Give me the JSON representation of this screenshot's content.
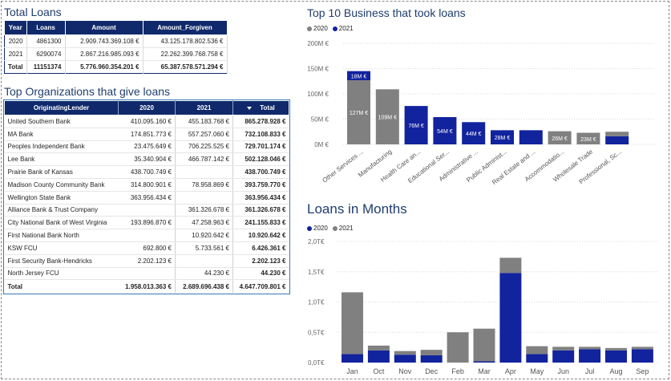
{
  "colors": {
    "c2020": "#808080",
    "c2021": "#12239e",
    "header": "#10296b",
    "title": "#1f3d6d"
  },
  "totals": {
    "title": "Total Loans",
    "headers": [
      "Year",
      "Loans",
      "Amount",
      "Amount_Forgiven"
    ],
    "rows": [
      [
        "2020",
        "4861300",
        "2.909.743.369.108 €",
        "43.125.178.802.536 €"
      ],
      [
        "2021",
        "6290074",
        "2.867.216.985.093 €",
        "22.262.399.768.758 €"
      ],
      [
        "Total",
        "11151374",
        "5.776.960.354.201 €",
        "65.387.578.571.294 €"
      ]
    ]
  },
  "orgs": {
    "title": "Top Organizations that give loans",
    "headers": [
      "OriginatingLender",
      "2020",
      "2021",
      "Total"
    ],
    "rows": [
      [
        "United Southern Bank",
        "410.095.160 €",
        "455.183.768 €",
        "865.278.928 €"
      ],
      [
        "MA Bank",
        "174.851.773 €",
        "557.257.060 €",
        "732.108.833 €"
      ],
      [
        "Peoples Independent Bank",
        "23.475.649 €",
        "706.225.525 €",
        "729.701.174 €"
      ],
      [
        "Lee Bank",
        "35.340.904 €",
        "466.787.142 €",
        "502.128.046 €"
      ],
      [
        "Prairie Bank of Kansas",
        "438.700.749 €",
        "",
        "438.700.749 €"
      ],
      [
        "Madison County Community Bank",
        "314.800.901 €",
        "78.958.869 €",
        "393.759.770 €"
      ],
      [
        "Wellington State Bank",
        "363.956.434 €",
        "",
        "363.956.434 €"
      ],
      [
        "Alliance Bank & Trust Company",
        "",
        "361.326.678 €",
        "361.326.678 €"
      ],
      [
        "City National Bank of West Virginia",
        "193.896.870 €",
        "47.258.963 €",
        "241.155.833 €"
      ],
      [
        "First National Bank North",
        "",
        "10.920.642 €",
        "10.920.642 €"
      ],
      [
        "KSW FCU",
        "692.800 €",
        "5.733.561 €",
        "6.426.361 €"
      ],
      [
        "First Security Bank-Hendricks",
        "2.202.123 €",
        "",
        "2.202.123 €"
      ],
      [
        "North Jersey FCU",
        "",
        "44.230 €",
        "44.230 €"
      ]
    ],
    "total": [
      "Total",
      "1.958.013.363 €",
      "2.689.696.438 €",
      "4.647.709.801 €"
    ]
  },
  "chart_data": [
    {
      "type": "bar",
      "title": "Top 10 Business that took loans",
      "legend": [
        "2020",
        "2021"
      ],
      "y_ticks": [
        "0M €",
        "50M €",
        "100M €",
        "150M €",
        "200M €"
      ],
      "ylim": [
        0,
        200
      ],
      "categories": [
        "Other Services ...",
        "Manufacturing",
        "Health Care an...",
        "Educational Ser...",
        "Administrative ...",
        "Public Administ...",
        "Real Estate and ...",
        "Accommodatio...",
        "Wholesale Trade",
        "Professional, Sc..."
      ],
      "series": [
        {
          "name": "2020",
          "values": [
            127,
            109,
            0,
            0,
            0,
            0,
            0,
            26,
            23,
            0
          ],
          "labels": [
            "127M €",
            "109M €",
            "",
            "",
            "",
            "",
            "",
            "26M €",
            "23M €",
            ""
          ]
        },
        {
          "name": "2021",
          "values": [
            18,
            0,
            76,
            54,
            44,
            28,
            28,
            0,
            0,
            16
          ],
          "labels": [
            "18M €",
            "",
            "76M €",
            "54M €",
            "44M €",
            "28M €",
            "",
            "",
            "",
            ""
          ]
        }
      ],
      "extra": [
        null,
        null,
        null,
        null,
        null,
        null,
        null,
        null,
        null,
        9
      ]
    },
    {
      "type": "bar",
      "stacked": true,
      "title": "Loans in Months",
      "legend": [
        "2020",
        "2021"
      ],
      "y_ticks": [
        "0,0T€",
        "0,5T€",
        "1,0T€",
        "1,5T€",
        "2,0T€"
      ],
      "ylim": [
        0,
        2.0
      ],
      "categories": [
        "Jan",
        "Oct",
        "Nov",
        "Dec",
        "Feb",
        "Mar",
        "Apr",
        "May",
        "Jun",
        "Jul",
        "Aug",
        "Sep"
      ],
      "series": [
        {
          "name": "2021",
          "values": [
            0.14,
            0.2,
            0.13,
            0.12,
            0.0,
            0.02,
            1.48,
            0.14,
            0.2,
            0.22,
            0.2,
            0.22
          ]
        },
        {
          "name": "2020",
          "values": [
            1.02,
            0.08,
            0.06,
            0.09,
            0.5,
            0.54,
            0.25,
            0.13,
            0.06,
            0.04,
            0.04,
            0.04
          ]
        }
      ]
    }
  ]
}
